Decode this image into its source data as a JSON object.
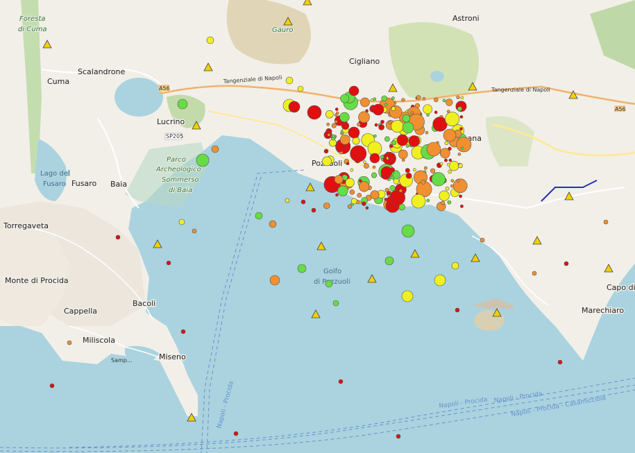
{
  "map": {
    "place_labels": [
      {
        "text": "Astroni",
        "kind": "town"
      },
      {
        "text": "Cigliano",
        "kind": "town"
      },
      {
        "text": "Scalandrone",
        "kind": "town"
      },
      {
        "text": "Cuma",
        "kind": "town"
      },
      {
        "text": "Lucrino",
        "kind": "town"
      },
      {
        "text": "Fusaro",
        "kind": "town"
      },
      {
        "text": "Baia",
        "kind": "town"
      },
      {
        "text": "Pozzuoli",
        "kind": "town"
      },
      {
        "text": "Torregaveta",
        "kind": "town"
      },
      {
        "text": "Monte di Procida",
        "kind": "town"
      },
      {
        "text": "Cappella",
        "kind": "town"
      },
      {
        "text": "Bacoli",
        "kind": "town"
      },
      {
        "text": "Miliscola",
        "kind": "town"
      },
      {
        "text": "Miseno",
        "kind": "town"
      },
      {
        "text": "Marechiaro",
        "kind": "town"
      },
      {
        "text": "Capo di",
        "kind": "town"
      },
      {
        "text": "Agnana",
        "kind": "town"
      }
    ],
    "park_labels": [
      {
        "text": "Foresta"
      },
      {
        "text": "di Cuma"
      },
      {
        "text": "Gauro"
      },
      {
        "text": "Parco"
      },
      {
        "text": "Archeologico"
      },
      {
        "text": "Sommerso"
      },
      {
        "text": "di Baia"
      }
    ],
    "water_labels": [
      {
        "text": "Lago del"
      },
      {
        "text": "Fusaro"
      },
      {
        "text": "Golfo"
      },
      {
        "text": "di Pozzuoli"
      }
    ],
    "road_labels": [
      {
        "text": "Tangenziale di Napoli"
      },
      {
        "text": "Tangenziale di Napoli"
      },
      {
        "text": "A56"
      },
      {
        "text": "A56"
      },
      {
        "text": "SP205"
      },
      {
        "text": "Samp..."
      }
    ],
    "ferry_labels": [
      {
        "text": "Napoli - Procida"
      },
      {
        "text": "Napoli - Procida"
      },
      {
        "text": "Napoli - Procida - Casamicciola"
      },
      {
        "text": "Napoli - Procida"
      }
    ],
    "legend_colors": {
      "green": "#66dd44",
      "yellow": "#f0f020",
      "orange": "#f09030",
      "red": "#e01010",
      "station": "#f2d000"
    }
  }
}
